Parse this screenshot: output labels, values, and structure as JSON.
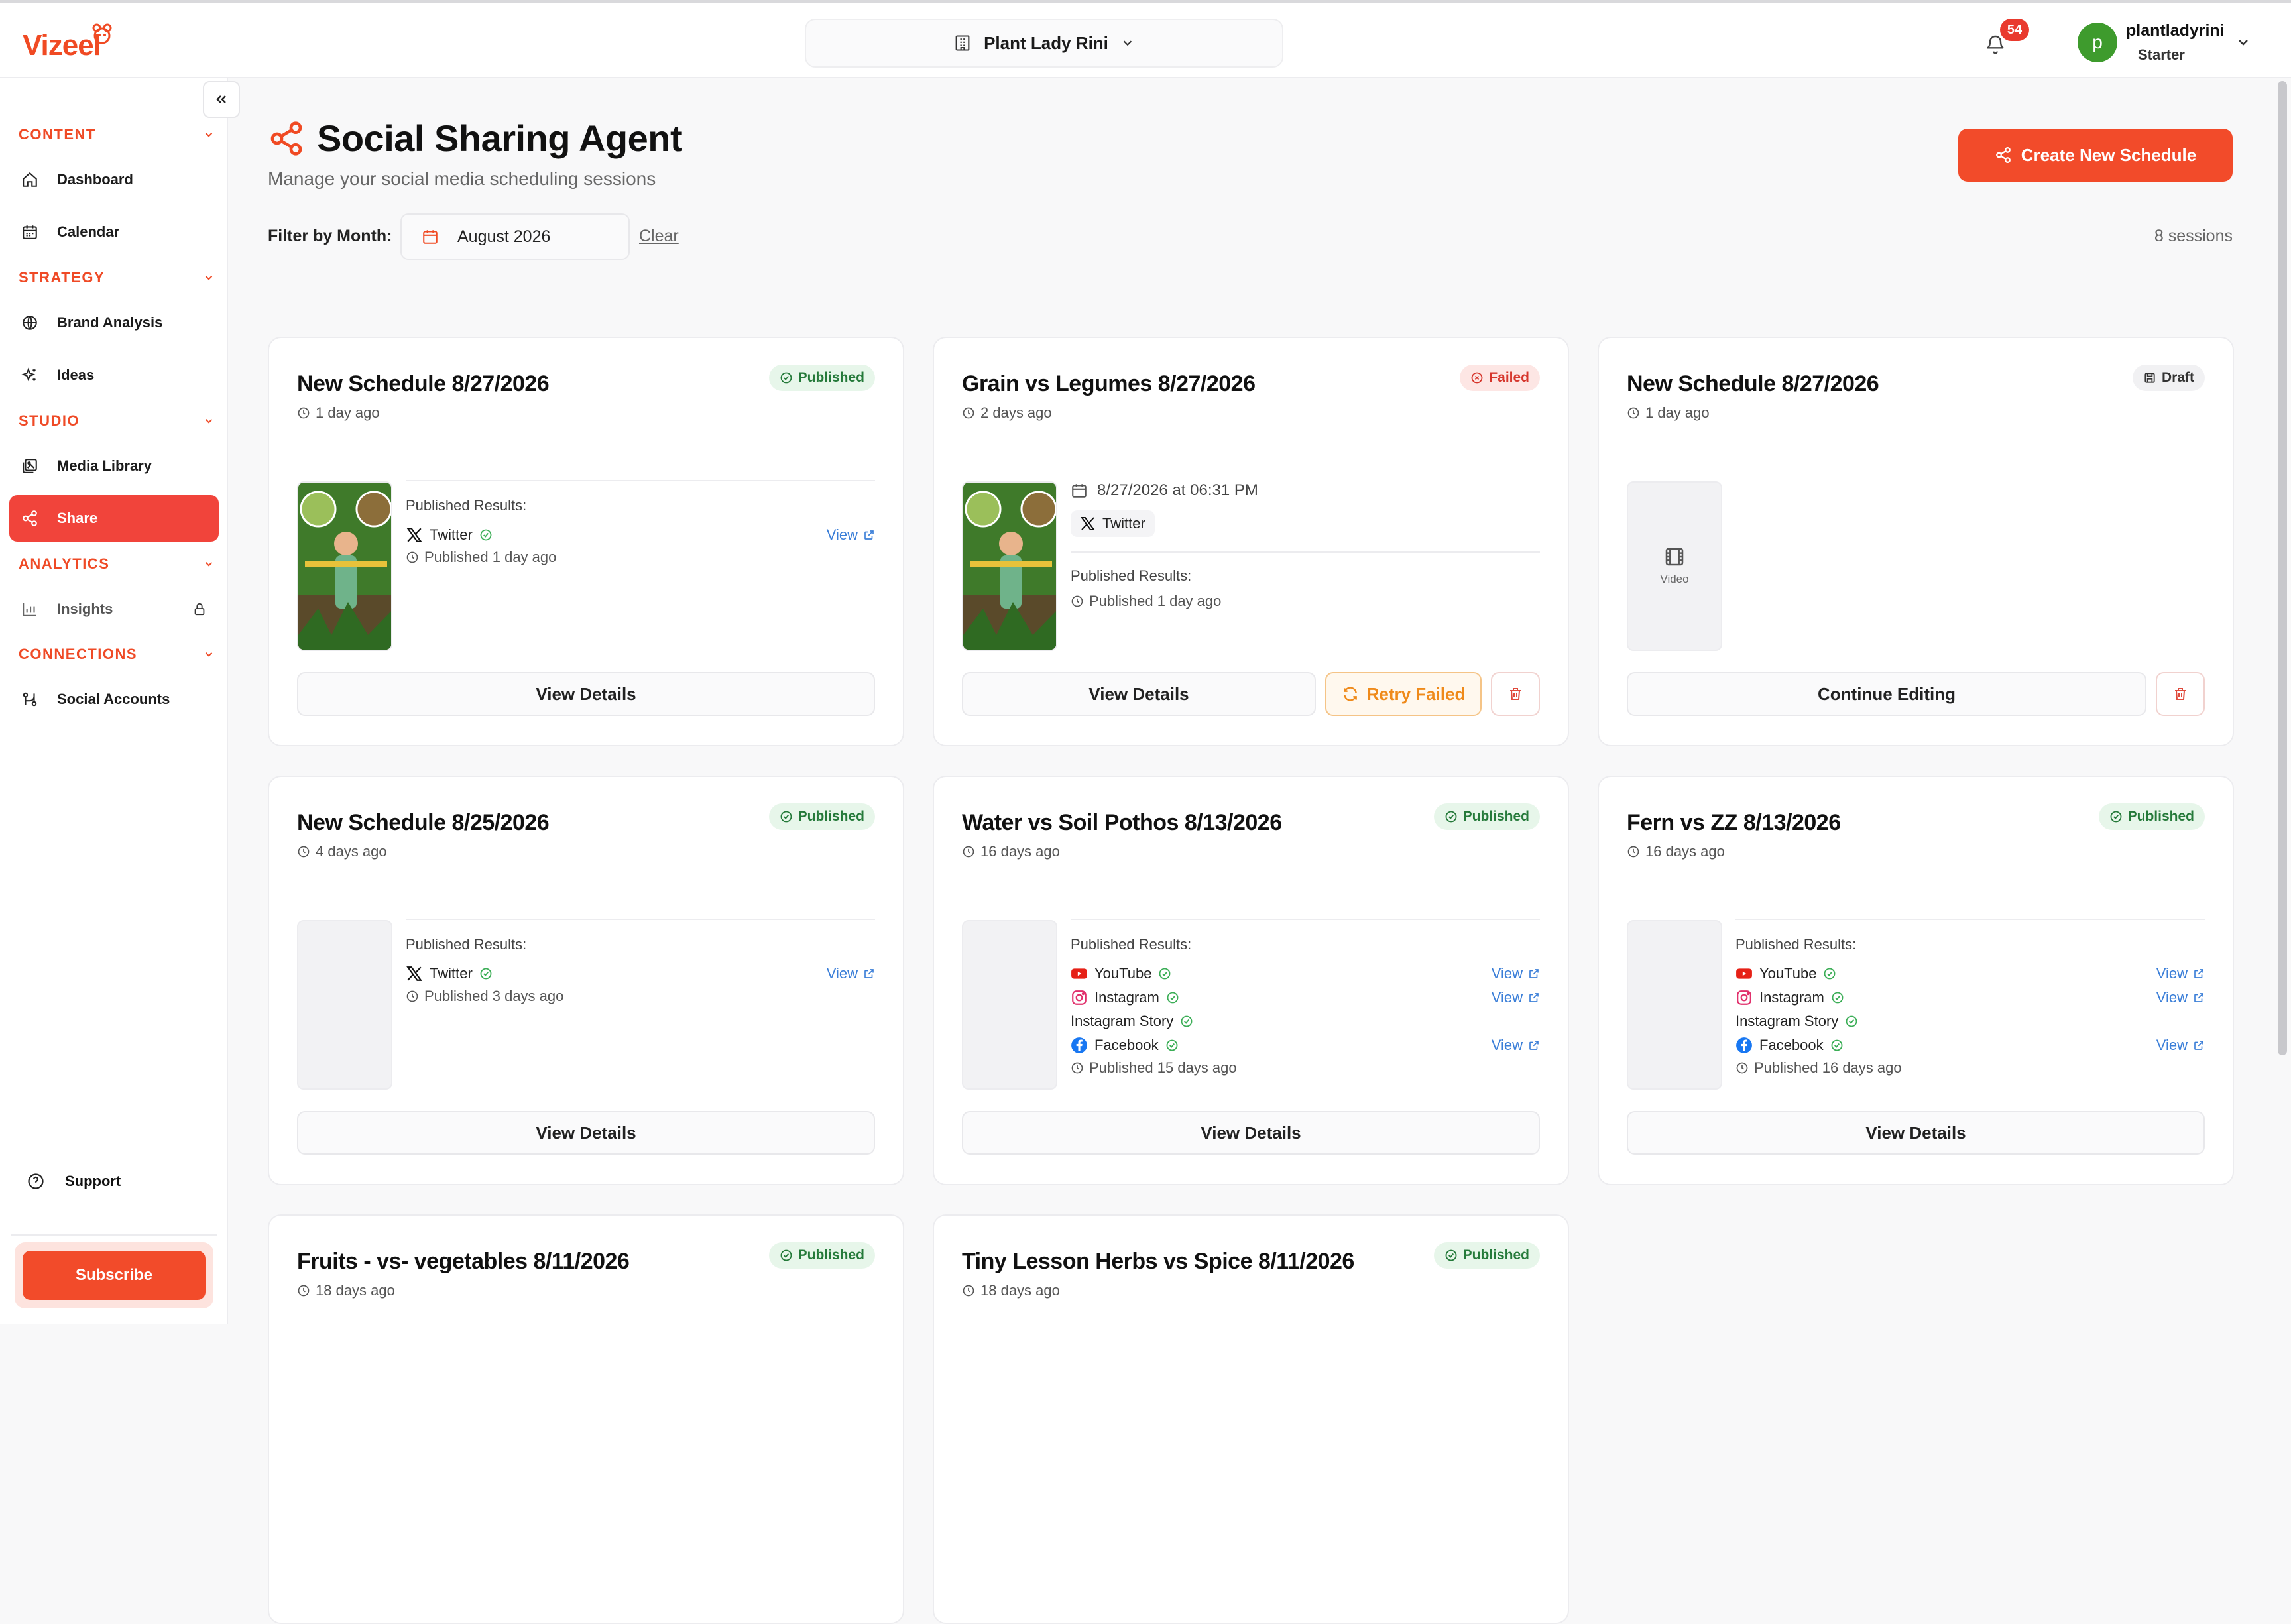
{
  "app": {
    "logo_text": "Vizeel"
  },
  "header": {
    "brand_selector": "Plant Lady Rini",
    "notifications_count": "54",
    "user": {
      "avatar_letter": "p",
      "name": "plantladyrini",
      "plan": "Starter"
    }
  },
  "sidebar": {
    "sections": [
      {
        "label": "CONTENT"
      },
      {
        "label": "STRATEGY"
      },
      {
        "label": "STUDIO"
      },
      {
        "label": "ANALYTICS"
      },
      {
        "label": "CONNECTIONS"
      }
    ],
    "items": [
      {
        "label": "Dashboard",
        "icon": "home-icon"
      },
      {
        "label": "Calendar",
        "icon": "calendar-icon"
      },
      {
        "label": "Brand Analysis",
        "icon": "globe-icon"
      },
      {
        "label": "Ideas",
        "icon": "sparkles-icon"
      },
      {
        "label": "Media Library",
        "icon": "images-icon"
      },
      {
        "label": "Share",
        "icon": "share-icon",
        "active": true
      },
      {
        "label": "Insights",
        "icon": "bar-chart-icon",
        "locked": true
      },
      {
        "label": "Social Accounts",
        "icon": "link-icon"
      }
    ],
    "support": "Support",
    "subscribe": "Subscribe"
  },
  "page": {
    "title": "Social Sharing Agent",
    "subtitle": "Manage your social media scheduling sessions",
    "create_button": "Create New Schedule",
    "filter_label": "Filter by Month:",
    "filter_value": "August 2026",
    "clear": "Clear",
    "session_count": "8 sessions"
  },
  "common": {
    "published_results": "Published Results:",
    "view": "View",
    "view_details": "View Details",
    "retry_failed": "Retry Failed",
    "continue_editing": "Continue Editing",
    "video": "Video"
  },
  "cards": [
    {
      "title": "New Schedule 8/27/2026",
      "status": "Published",
      "time": "1 day ago",
      "platforms": [
        {
          "name": "Twitter",
          "view": true
        }
      ],
      "published": "Published 1 day ago"
    },
    {
      "title": "Grain vs Legumes 8/27/2026",
      "status": "Failed",
      "time": "2 days ago",
      "scheduled": "8/27/2026 at 06:31 PM",
      "platform_pill": "Twitter",
      "published": "Published 1 day ago"
    },
    {
      "title": "New Schedule 8/27/2026",
      "status": "Draft",
      "time": "1 day ago"
    },
    {
      "title": "New Schedule 8/25/2026",
      "status": "Published",
      "time": "4 days ago",
      "platforms": [
        {
          "name": "Twitter",
          "view": true
        }
      ],
      "published": "Published 3 days ago"
    },
    {
      "title": "Water vs Soil Pothos 8/13/2026",
      "status": "Published",
      "time": "16 days ago",
      "platforms": [
        {
          "name": "YouTube",
          "view": true
        },
        {
          "name": "Instagram",
          "view": true
        },
        {
          "name": "Instagram Story",
          "view": false
        },
        {
          "name": "Facebook",
          "view": true
        }
      ],
      "published": "Published 15 days ago"
    },
    {
      "title": "Fern vs ZZ 8/13/2026",
      "status": "Published",
      "time": "16 days ago",
      "platforms": [
        {
          "name": "YouTube",
          "view": true
        },
        {
          "name": "Instagram",
          "view": true
        },
        {
          "name": "Instagram Story",
          "view": false
        },
        {
          "name": "Facebook",
          "view": true
        }
      ],
      "published": "Published 16 days ago"
    },
    {
      "title": "Fruits - vs- vegetables 8/11/2026",
      "status": "Published",
      "time": "18 days ago"
    },
    {
      "title": "Tiny Lesson Herbs vs Spice 8/11/2026",
      "status": "Published",
      "time": "18 days ago"
    }
  ],
  "colors": {
    "accent": "#f24b2a",
    "published": "#257a3a",
    "failed": "#d6362c",
    "link": "#3a7ed8"
  }
}
